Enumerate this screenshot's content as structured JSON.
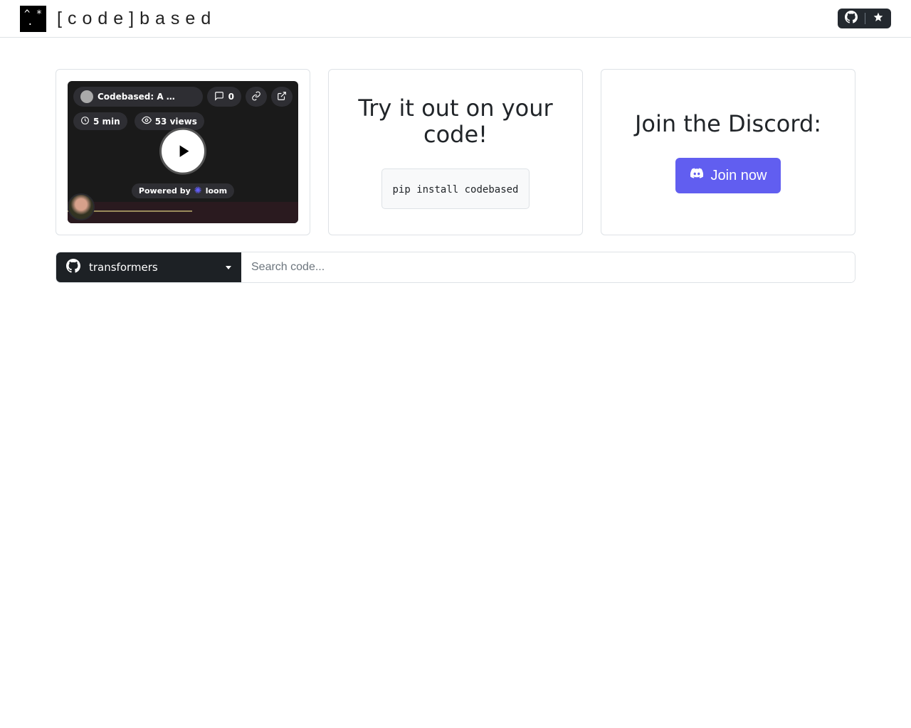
{
  "brand": {
    "name": "[code]based"
  },
  "cards": {
    "video": {
      "title": "Codebased: A …",
      "comments": "0",
      "duration": "5 min",
      "views": "53 views",
      "powered": "Powered by",
      "loom": "loom"
    },
    "try": {
      "heading": "Try it out on your code!",
      "code": "pip install codebased"
    },
    "discord": {
      "heading": "Join the Discord:",
      "button": "Join now"
    }
  },
  "search": {
    "repo": "transformers",
    "placeholder": "Search code..."
  }
}
